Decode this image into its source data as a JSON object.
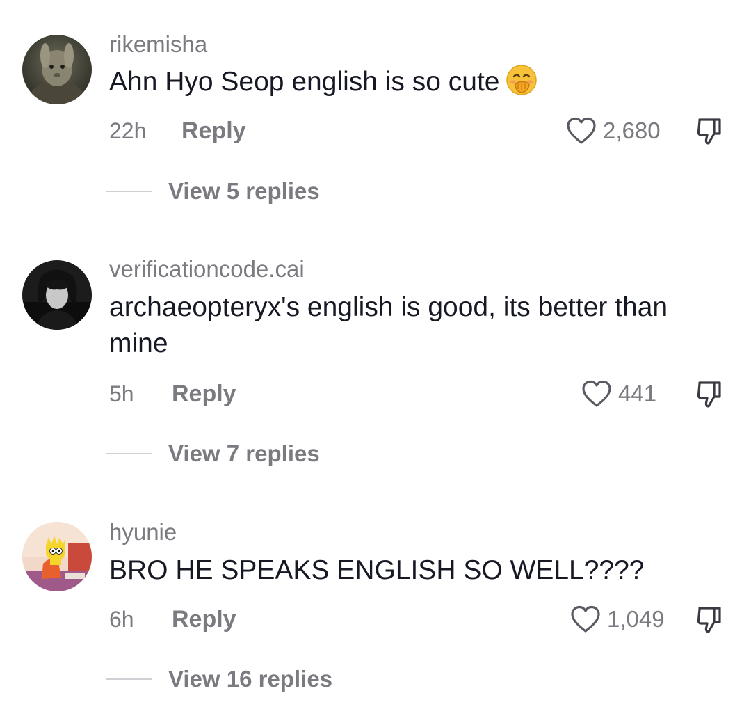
{
  "comments": [
    {
      "username": "rikemisha",
      "text": "Ahn Hyo Seop english is so cute",
      "emoji": "hand-over-mouth-emoji",
      "time": "22h",
      "reply_label": "Reply",
      "likes": "2,680",
      "view_replies": "View 5 replies"
    },
    {
      "username": "verificationcode.cai",
      "text": "archaeopteryx's english is good, its better than mine",
      "time": "5h",
      "reply_label": "Reply",
      "likes": "441",
      "view_replies": "View 7 replies"
    },
    {
      "username": "hyunie",
      "text": "BRO HE SPEAKS ENGLISH SO WELL????",
      "time": "6h",
      "reply_label": "Reply",
      "likes": "1,049",
      "view_replies": "View 16 replies"
    }
  ],
  "icons": {
    "like": "heart-icon",
    "dislike": "thumbs-down-icon"
  },
  "colors": {
    "secondary_text": "#7a7a80",
    "primary_text": "#161823"
  }
}
